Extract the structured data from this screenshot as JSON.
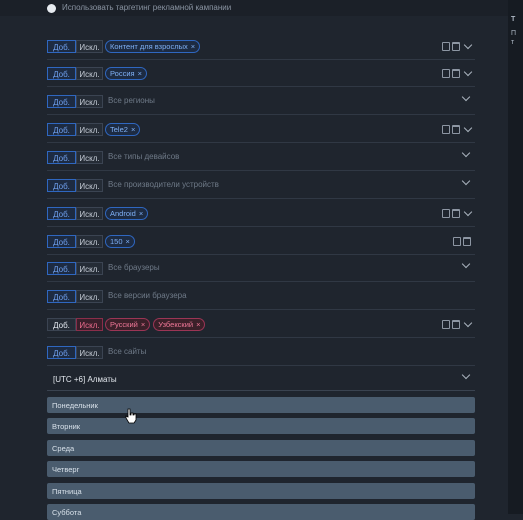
{
  "header": {
    "text": "Использовать таргетинг рекламной кампании"
  },
  "right_panel": {
    "letters": [
      "Т",
      "П",
      "т"
    ]
  },
  "labels": {
    "add": "Доб.",
    "exclude": "Искл."
  },
  "rows": [
    {
      "chips": [
        "Контент для взрослых"
      ],
      "placeholder": ""
    },
    {
      "chips": [
        "Россия"
      ],
      "placeholder": ""
    },
    {
      "chips": [],
      "placeholder": "Все регионы"
    },
    {
      "chips": [
        "Tele2"
      ],
      "placeholder": ""
    },
    {
      "chips": [],
      "placeholder": "Все типы девайсов"
    },
    {
      "chips": [],
      "placeholder": "Все производители устройств"
    },
    {
      "chips": [
        "Android"
      ],
      "placeholder": ""
    },
    {
      "chips": [
        "150"
      ],
      "placeholder": ""
    },
    {
      "chips": [],
      "placeholder": "Все браузеры"
    },
    {
      "chips": [],
      "placeholder": "Все версии браузера"
    },
    {
      "chips": [
        "Русский",
        "Узбекский"
      ],
      "placeholder": ""
    },
    {
      "chips": [],
      "placeholder": "Все сайты"
    }
  ],
  "timezone": {
    "value": "[UTC +6] Алматы"
  },
  "days": [
    "Понедельник",
    "Вторник",
    "Среда",
    "Четверг",
    "Пятница",
    "Суббота"
  ],
  "colors": {
    "accent": "#2f67c0",
    "danger": "#ef6d8e",
    "day_bar": "#4a5c6e"
  }
}
